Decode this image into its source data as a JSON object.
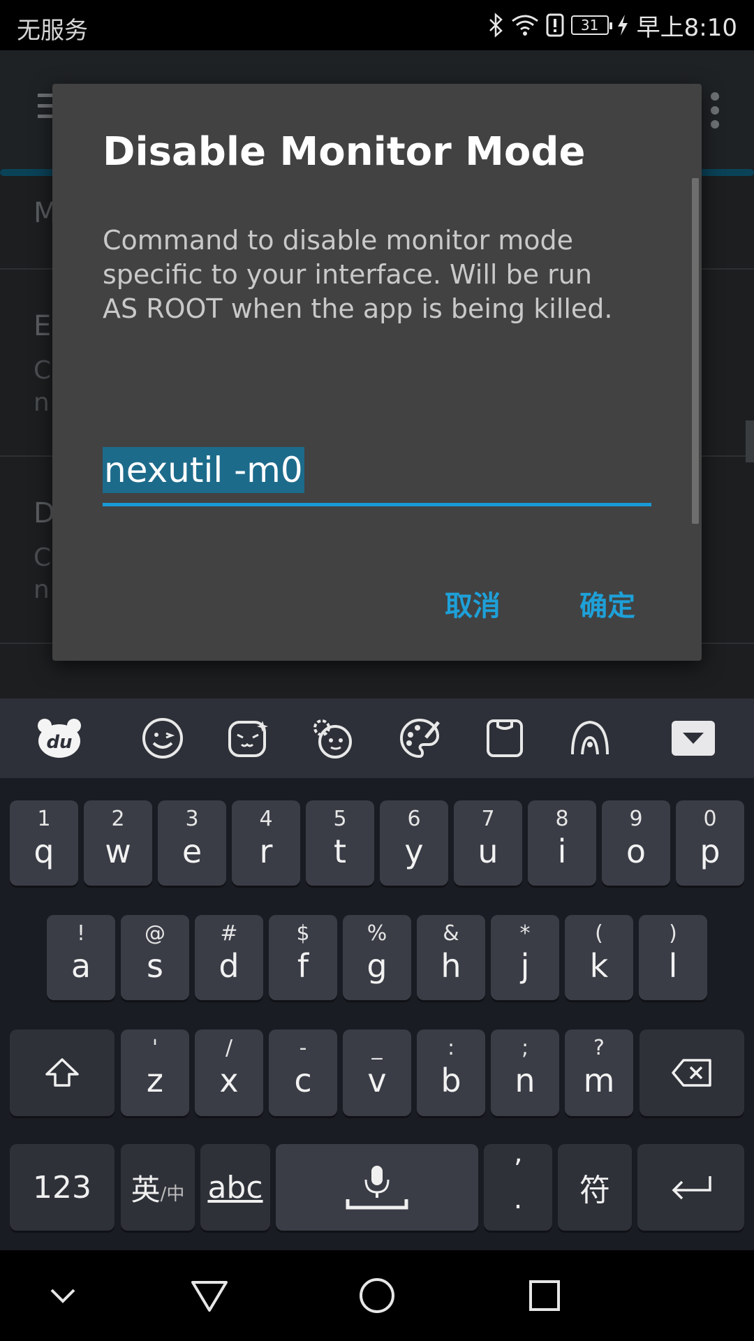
{
  "status_bar": {
    "carrier": "无服务",
    "battery": "31",
    "time": "早上8:10",
    "icons": [
      "bluetooth-icon",
      "wifi-icon",
      "alert-icon",
      "battery-icon",
      "charging-icon"
    ]
  },
  "background": {
    "prefs": [
      {
        "letter": "M",
        "sub": ""
      },
      {
        "letter": "E",
        "sub": "C"
      },
      {
        "letter": "",
        "sub": "n"
      },
      {
        "letter": "D",
        "sub": "C"
      },
      {
        "letter": "",
        "sub": "n"
      }
    ]
  },
  "dialog": {
    "title": "Disable Monitor Mode",
    "message": "Command to disable monitor mode specific to your interface. Will be run AS ROOT when the app is being killed.",
    "input_value": "nexutil -m0",
    "cancel_label": "取消",
    "ok_label": "确定"
  },
  "keyboard": {
    "toolbar_icons": [
      "du-logo-icon",
      "emoji-icon",
      "kaomoji-icon",
      "sticker-icon",
      "skin-palette-icon",
      "clipboard-icon",
      "handwriting-icon"
    ],
    "row1": [
      {
        "hint": "1",
        "key": "q"
      },
      {
        "hint": "2",
        "key": "w"
      },
      {
        "hint": "3",
        "key": "e"
      },
      {
        "hint": "4",
        "key": "r"
      },
      {
        "hint": "5",
        "key": "t"
      },
      {
        "hint": "6",
        "key": "y"
      },
      {
        "hint": "7",
        "key": "u"
      },
      {
        "hint": "8",
        "key": "i"
      },
      {
        "hint": "9",
        "key": "o"
      },
      {
        "hint": "0",
        "key": "p"
      }
    ],
    "row2": [
      {
        "hint": "!",
        "key": "a"
      },
      {
        "hint": "@",
        "key": "s"
      },
      {
        "hint": "#",
        "key": "d"
      },
      {
        "hint": "$",
        "key": "f"
      },
      {
        "hint": "%",
        "key": "g"
      },
      {
        "hint": "&",
        "key": "h"
      },
      {
        "hint": "*",
        "key": "j"
      },
      {
        "hint": "(",
        "key": "k"
      },
      {
        "hint": ")",
        "key": "l"
      }
    ],
    "row3": [
      {
        "hint": "'",
        "key": "z"
      },
      {
        "hint": "/",
        "key": "x"
      },
      {
        "hint": "-",
        "key": "c"
      },
      {
        "hint": "_",
        "key": "v"
      },
      {
        "hint": ":",
        "key": "b"
      },
      {
        "hint": ";",
        "key": "n"
      },
      {
        "hint": "?",
        "key": "m"
      }
    ],
    "num_label": "123",
    "lang_label_main": "英",
    "lang_label_sub": "/中",
    "abc_label": "abc",
    "punct_top": "’",
    "punct_bottom": ".",
    "symbol_label": "符"
  },
  "colors": {
    "accent": "#1ea0d8",
    "dialog_bg": "#424242",
    "keyboard_bg": "#1a1c23",
    "key_bg": "#3a3d46"
  }
}
